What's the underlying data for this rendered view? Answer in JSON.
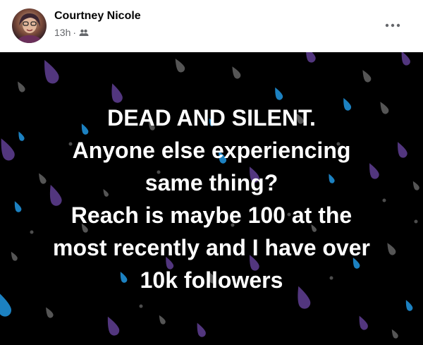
{
  "author": {
    "name": "Courtney Nicole"
  },
  "meta": {
    "time": "13h",
    "separator": "·",
    "audience_icon": "friends-icon"
  },
  "menu": {
    "icon": "more-options-icon"
  },
  "status": {
    "background": "#000000",
    "text_color": "#ffffff",
    "drop_colors": [
      "#5b3c8c",
      "#1f8fd6",
      "#9a9a9a"
    ],
    "lines": [
      "DEAD AND SILENT.",
      "Anyone else experiencing",
      "same thing?",
      "Reach is maybe 100 at the",
      "most recently and I have over",
      "10k followers"
    ]
  }
}
